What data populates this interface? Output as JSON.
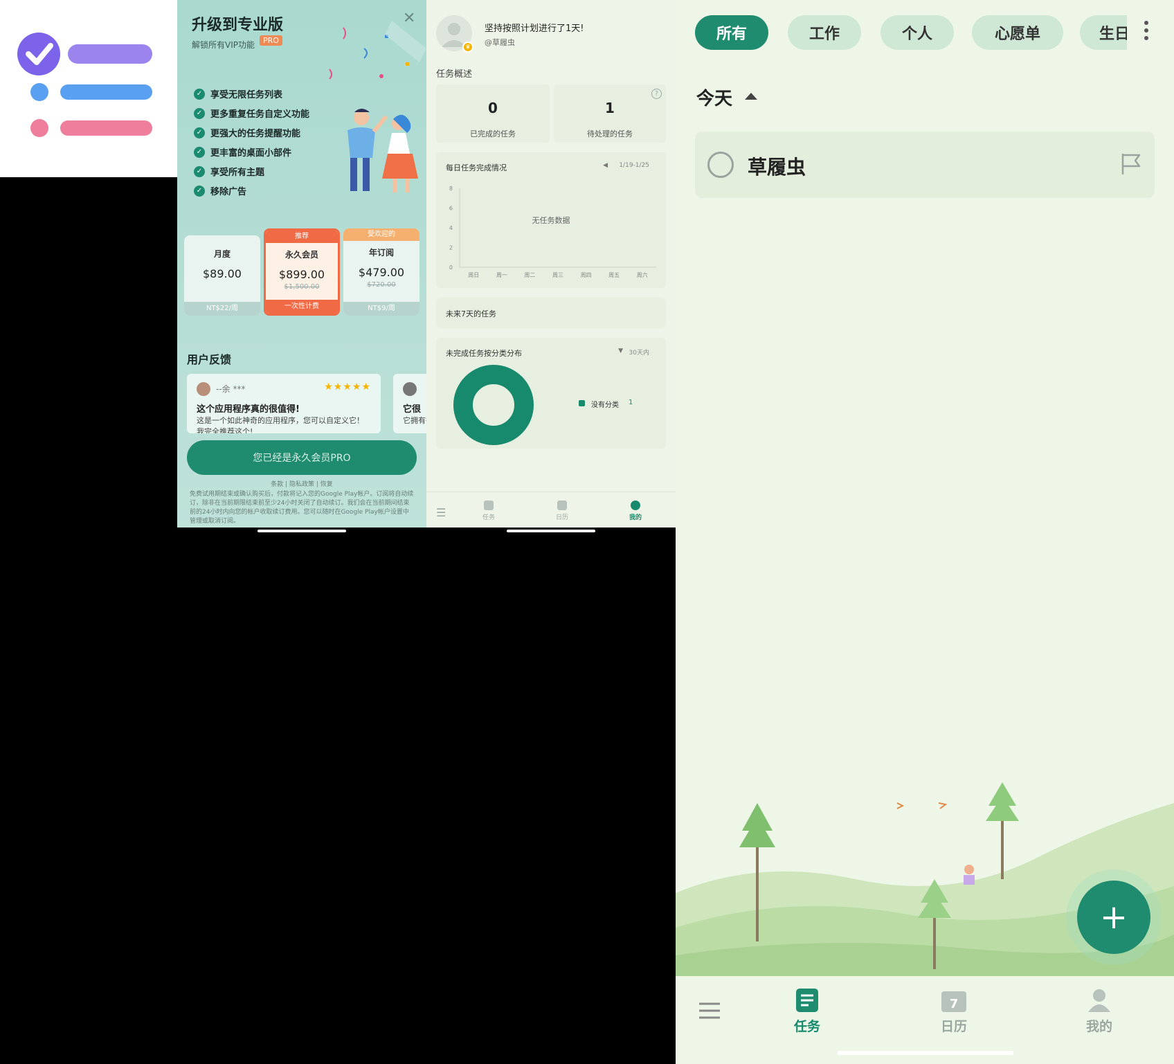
{
  "upgrade": {
    "title": "升级到专业版",
    "subtitle": "解锁所有VIP功能",
    "pro_badge": "PRO",
    "close_icon": "close-icon",
    "features": [
      "享受无限任务列表",
      "更多重复任务自定义功能",
      "更强大的任务提醒功能",
      "更丰富的桌面小部件",
      "享受所有主题",
      "移除广告"
    ],
    "plans": [
      {
        "tag": "",
        "name": "月度",
        "price": "$89.00",
        "old_price": "",
        "footer": "NT$22/周"
      },
      {
        "tag": "推荐",
        "name": "永久会员",
        "price": "$899.00",
        "old_price": "$1,500.00",
        "footer": "一次性计费"
      },
      {
        "tag": "受欢迎的",
        "name": "年订阅",
        "price": "$479.00",
        "old_price": "$720.00",
        "footer": "NT$9/周"
      }
    ],
    "feedback_title": "用户反馈",
    "reviews": [
      {
        "name": "--余 ***",
        "stars": "★★★★★",
        "headline": "这个应用程序真的很值得!",
        "body": "这是一个如此神奇的应用程序，您可以自定义它！我完全推荐这个!"
      },
      {
        "name": "",
        "stars": "",
        "headline": "它很",
        "body": "它拥有很多"
      }
    ],
    "cta": "您已经是永久会员PRO",
    "links": "条款 | 隐私政策 | 恢复",
    "fine_print": "免费试用期结束或确认购买后，付款将记入您的Google Play帐户。订阅将自动续订，除非在当前期限结束前至少24小时关闭了自动续订。我们会在当前期间结束前的24小时内向您的帐户收取续订费用。您可以随时在Google Play帐户设置中管理或取消订阅。"
  },
  "profile": {
    "motto": "坚持按照计划进行了1天!",
    "username": "@草履虫",
    "overview_title": "任务概述",
    "completed_count": "0",
    "completed_label": "已完成的任务",
    "pending_count": "1",
    "pending_label": "待处理的任务",
    "help_icon": "help-icon",
    "daily_title": "每日任务完成情况",
    "daily_range": "1/19-1/25",
    "daily_empty": "无任务数据",
    "next7_title": "未来7天的任务",
    "category_title": "未完成任务按分类分布",
    "category_range": "30天内",
    "category_legend": "没有分类",
    "category_count": "1",
    "nav": [
      "任务",
      "日历",
      "我的"
    ]
  },
  "chart_data": [
    {
      "type": "bar",
      "title": "每日任务完成情况",
      "categories": [
        "周日",
        "周一",
        "周二",
        "周三",
        "周四",
        "周五",
        "周六"
      ],
      "values": [
        0,
        0,
        0,
        0,
        0,
        0,
        0
      ],
      "y_ticks": [
        "0",
        "2",
        "4",
        "6",
        "8"
      ],
      "ylim": [
        0,
        8
      ]
    },
    {
      "type": "pie",
      "title": "未完成任务按分类分布",
      "series": [
        {
          "name": "没有分类",
          "values": [
            1
          ]
        }
      ],
      "colors": [
        "#178a6d"
      ]
    }
  ],
  "tasks": {
    "tabs": [
      "所有",
      "工作",
      "个人",
      "心愿单",
      "生日"
    ],
    "active_tab": 0,
    "section": "今天",
    "items": [
      {
        "title": "草履虫",
        "flag_icon": "flag-icon"
      }
    ],
    "fab": "+",
    "nav": [
      "任务",
      "日历",
      "我的"
    ],
    "calendar_day": "7",
    "accent": "#1f8c6f"
  }
}
